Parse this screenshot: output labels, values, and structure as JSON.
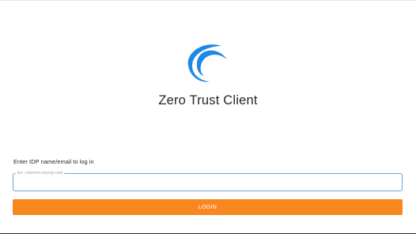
{
  "app": {
    "title": "Zero Trust Client",
    "logo_icon": "swoosh-logo-icon",
    "brand_color": "#1e88e5"
  },
  "login_form": {
    "prompt_label": "Enter IDP name/email to log in",
    "idp_field": {
      "placeholder": "Ex: connect.myorg.com",
      "value": ""
    },
    "login_button_label": "LOGIN",
    "button_color": "#f7871e"
  }
}
